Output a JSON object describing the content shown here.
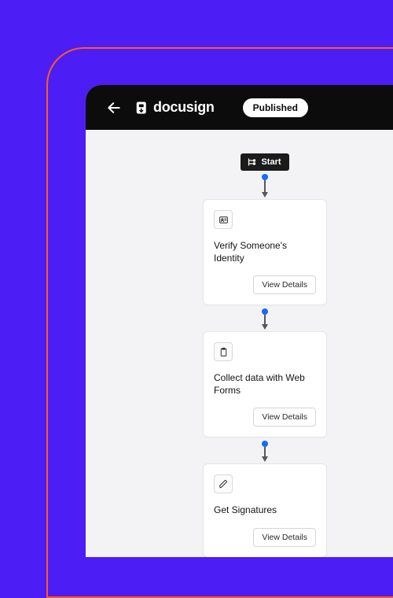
{
  "header": {
    "brand": "docusign",
    "status_badge": "Published"
  },
  "flow": {
    "start_label": "Start",
    "view_details_label": "View Details",
    "steps": [
      {
        "icon": "id-card-icon",
        "title": "Verify Someone's Identity"
      },
      {
        "icon": "clipboard-icon",
        "title": "Collect data with Web Forms"
      },
      {
        "icon": "pen-icon",
        "title": "Get Signatures"
      }
    ]
  },
  "colors": {
    "bg": "#4d1df5",
    "frame": "#ff5a1f",
    "accent_node": "#1769ff",
    "header_bg": "#0c0c0d"
  }
}
